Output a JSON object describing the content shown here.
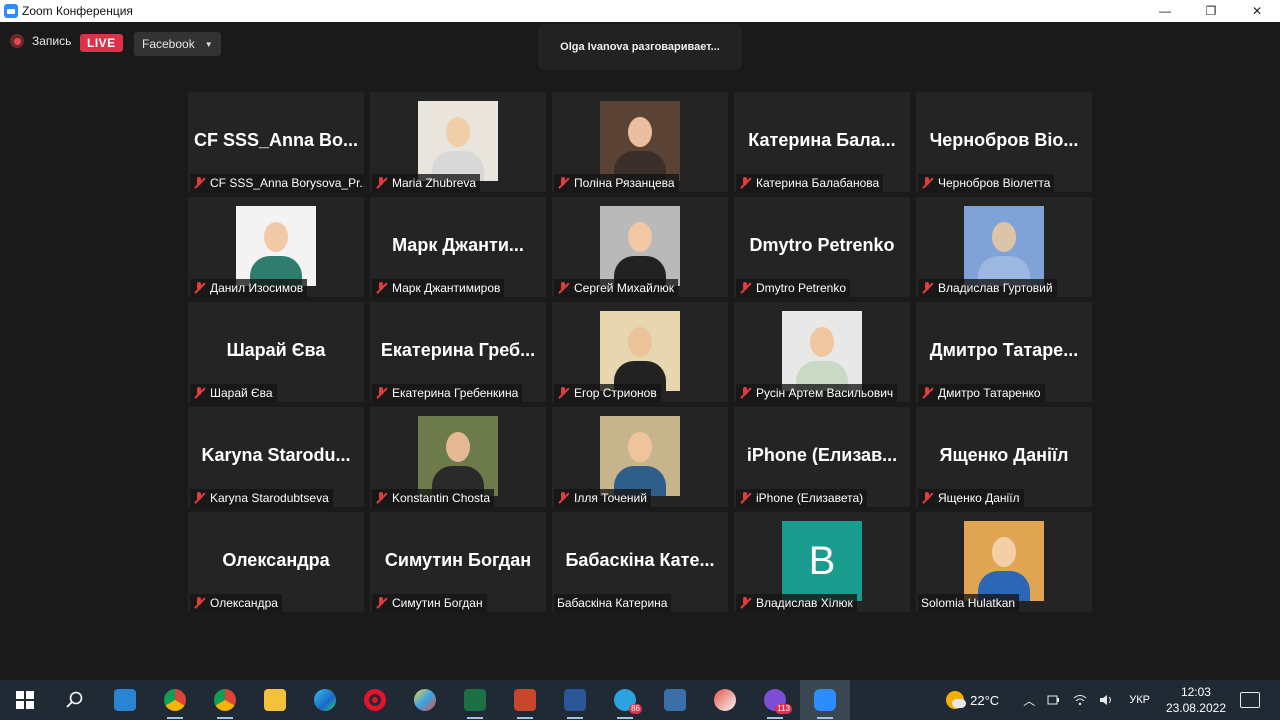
{
  "window": {
    "title": "Zoom Конференция",
    "minimize": "—",
    "restore": "❐",
    "close": "✕"
  },
  "toolbar": {
    "record_label": "Запись",
    "live_label": "LIVE",
    "stream_target": "Facebook",
    "dropdown_caret": "▼"
  },
  "speaking": "Olga Ivanova разговаривает...",
  "participants": [
    {
      "big": "CF SSS_Anna Bo...",
      "label": "CF SSS_Anna Borysova_Pr..."
    },
    {
      "big": "",
      "label": "Maria Zhubreva"
    },
    {
      "big": "",
      "label": "Поліна Рязанцева"
    },
    {
      "big": "Катерина  Бала...",
      "label": "Катерина Балабанова"
    },
    {
      "big": "Чернобров  Віо...",
      "label": "Чернобров Віолетта"
    },
    {
      "big": "",
      "label": "Данил Изосимов"
    },
    {
      "big": "Марк  Джанти...",
      "label": "Марк Джантимиров"
    },
    {
      "big": "",
      "label": "Сергей Михайлюк"
    },
    {
      "big": "Dmytro Petrenko",
      "label": "Dmytro Petrenko"
    },
    {
      "big": "",
      "label": "Владислав  Гуртовий"
    },
    {
      "big": "Шарай Єва",
      "label": "Шарай Єва"
    },
    {
      "big": "Екатерина  Греб...",
      "label": "Екатерина Гребенкина"
    },
    {
      "big": "",
      "label": "Егор Стрионов"
    },
    {
      "big": "",
      "label": "Русін Артем Васильович"
    },
    {
      "big": "Дмитро  Татаре...",
      "label": "Дмитро Татаренко"
    },
    {
      "big": "Karyna  Starodu...",
      "label": "Karyna Starodubtseva"
    },
    {
      "big": "",
      "label": "Konstantin Chosta"
    },
    {
      "big": "",
      "label": "Ілля Точений"
    },
    {
      "big": "iPhone  (Елизав...",
      "label": "iPhone (Елизавета)"
    },
    {
      "big": "Ященко Даніїл",
      "label": "Ященко Даніїл"
    },
    {
      "big": "Олександра",
      "label": "Олександра"
    },
    {
      "big": "Симутин Богдан",
      "label": "Симутин Богдан"
    },
    {
      "big": "Бабаскіна  Кате...",
      "label": "Бабаскіна Катерина"
    },
    {
      "big": "",
      "label": "Владислав Хілюк",
      "avatar_letter": "B"
    },
    {
      "big": "",
      "label": "Solomia Hulatkan"
    }
  ],
  "taskbar": {
    "telegram_badge": "86",
    "viber_badge": "113",
    "temperature": "22°C",
    "tray_chevron": "︿",
    "language": "УКР",
    "time": "12:03",
    "date": "23.08.2022"
  },
  "colors": {
    "live": "#e02f48",
    "muted_mic": "#e03e3e",
    "avatar_bg": "#199b8e"
  }
}
